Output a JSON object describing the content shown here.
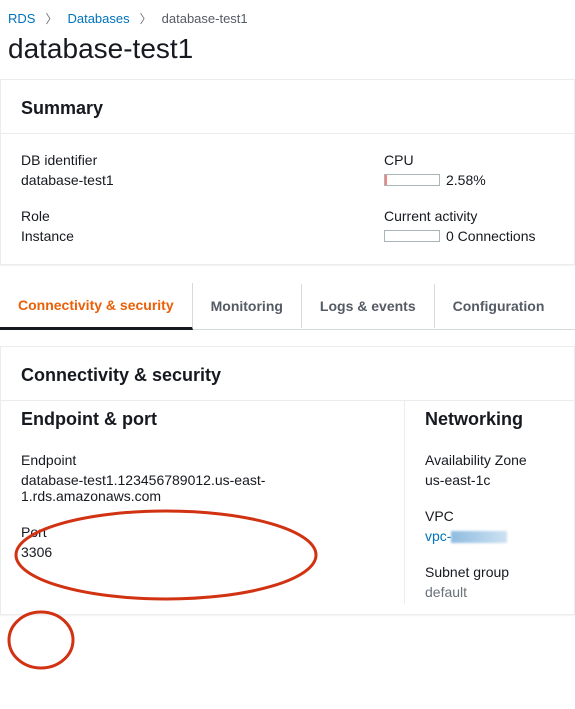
{
  "breadcrumb": {
    "root": "RDS",
    "databases": "Databases",
    "current": "database-test1"
  },
  "page_title": "database-test1",
  "summary": {
    "title": "Summary",
    "db_identifier_label": "DB identifier",
    "db_identifier_value": "database-test1",
    "role_label": "Role",
    "role_value": "Instance",
    "cpu_label": "CPU",
    "cpu_value": "2.58%",
    "cpu_percent": 2.58,
    "activity_label": "Current activity",
    "activity_value": "0 Connections",
    "activity_count": 0
  },
  "tabs": {
    "connectivity": "Connectivity & security",
    "monitoring": "Monitoring",
    "logs": "Logs & events",
    "configuration": "Configuration"
  },
  "connectivity": {
    "section_title": "Connectivity & security",
    "endpoint_port_title": "Endpoint & port",
    "endpoint_label": "Endpoint",
    "endpoint_value": "database-test1.123456789012.us-east-1.rds.amazonaws.com",
    "port_label": "Port",
    "port_value": "3306",
    "networking_title": "Networking",
    "az_label": "Availability Zone",
    "az_value": "us-east-1c",
    "vpc_label": "VPC",
    "vpc_value": "vpc-",
    "subnet_label": "Subnet group",
    "subnet_value": "default"
  }
}
